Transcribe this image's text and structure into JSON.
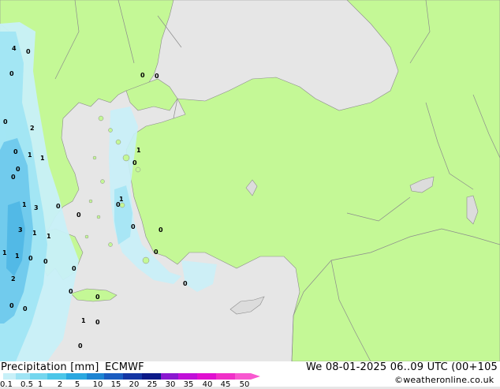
{
  "footer": {
    "title": "Precipitation [mm]",
    "model": "ECMWF",
    "valid_time": "We 08-01-2025 06..09 UTC (00+105",
    "credit": "©weatheronline.co.uk"
  },
  "legend": {
    "ticks": [
      "0.1",
      "0.5",
      "1",
      "2",
      "5",
      "10",
      "15",
      "20",
      "25",
      "30",
      "35",
      "40",
      "45",
      "50"
    ],
    "colors": [
      "#c8f0f8",
      "#9fe4f4",
      "#74d6ee",
      "#4cc6e8",
      "#2aa8e0",
      "#1d84d2",
      "#1a5cc0",
      "#1436a4",
      "#0c1a88",
      "#8a18d0",
      "#c010d8",
      "#e010d0",
      "#f030c8",
      "#f858d0"
    ]
  },
  "map_colors": {
    "sea": "#e6e6e6",
    "land": "#c4f896",
    "precip_light": "#c8f0f8",
    "precip_mid": "#9fe4f4",
    "precip_heavy": "#6cc8ec",
    "border": "#8c8c8c"
  },
  "cell_values": [
    "4",
    "0",
    "0",
    "0",
    "0",
    "0",
    "2",
    "0",
    "1",
    "0",
    "1",
    "0",
    "1",
    "3",
    "3",
    "1",
    "1",
    "1",
    "1",
    "0",
    "2",
    "1",
    "0",
    "1",
    "0",
    "0",
    "0",
    "0",
    "0",
    "0",
    "1",
    "0",
    "0",
    "0",
    "0",
    "0",
    "0",
    "0",
    "0",
    "0"
  ]
}
